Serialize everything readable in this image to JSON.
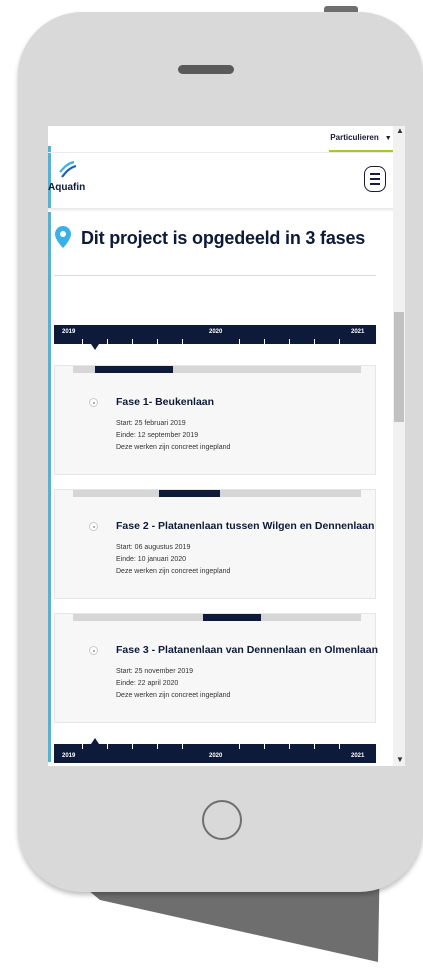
{
  "nav": {
    "audience_label": "Particulieren"
  },
  "brand": {
    "logo_text": "Aquafin"
  },
  "page": {
    "title": "Dit project is opgedeeld in 3 fases"
  },
  "timeline": {
    "years": [
      "2019",
      "2020",
      "2021"
    ]
  },
  "phases": [
    {
      "title": "Fase 1- Beukenlaan",
      "start": "Start: 25 februari 2019",
      "end": "Einde: 12 september 2019",
      "status": "Deze werken zijn concreet ingepland"
    },
    {
      "title": "Fase 2 - Platanenlaan tussen Wilgen en Dennenlaan",
      "start": "Start: 06 augustus 2019",
      "end": "Einde: 10 januari 2020",
      "status": "Deze werken zijn concreet ingepland"
    },
    {
      "title": "Fase 3 - Platanenlaan van Dennenlaan en Olmenlaan",
      "start": "Start: 25 november 2019",
      "end": "Einde: 22 april 2020",
      "status": "Deze werken zijn concreet ingepland"
    }
  ],
  "colors": {
    "navy": "#0e1a3a",
    "accent_cyan": "#49b7d9",
    "pin_blue": "#3ab0e8",
    "underline_green": "#a6c829"
  },
  "icons": {
    "location": "map-pin-icon",
    "menu": "hamburger-menu-icon",
    "logo": "aquafin-wave-icon"
  }
}
